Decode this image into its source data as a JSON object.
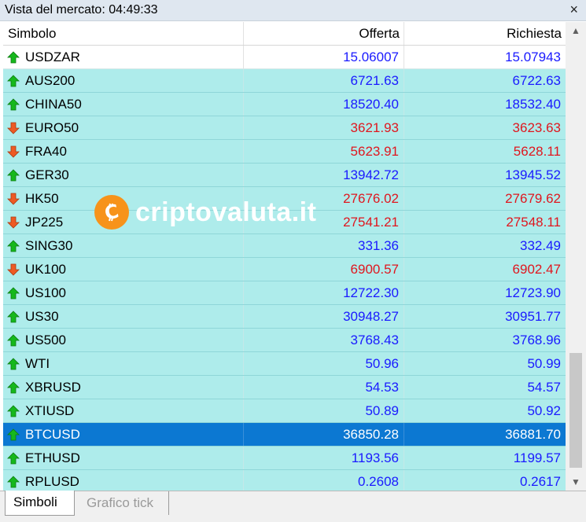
{
  "window": {
    "title": "Vista del mercato: 04:49:33",
    "close_icon": "close-icon"
  },
  "columns": {
    "symbol": "Simbolo",
    "bid": "Offerta",
    "ask": "Richiesta"
  },
  "colors": {
    "up": "#1a1aff",
    "down": "#e0161e",
    "row_bg": "#aeeceb",
    "selected_bg": "#0c78d2"
  },
  "rows": [
    {
      "symbol": "USDZAR",
      "bid": "15.06007",
      "ask": "15.07943",
      "dir": "up"
    },
    {
      "symbol": "AUS200",
      "bid": "6721.63",
      "ask": "6722.63",
      "dir": "up"
    },
    {
      "symbol": "CHINA50",
      "bid": "18520.40",
      "ask": "18532.40",
      "dir": "up"
    },
    {
      "symbol": "EURO50",
      "bid": "3621.93",
      "ask": "3623.63",
      "dir": "down"
    },
    {
      "symbol": "FRA40",
      "bid": "5623.91",
      "ask": "5628.11",
      "dir": "down"
    },
    {
      "symbol": "GER30",
      "bid": "13942.72",
      "ask": "13945.52",
      "dir": "up"
    },
    {
      "symbol": "HK50",
      "bid": "27676.02",
      "ask": "27679.62",
      "dir": "down"
    },
    {
      "symbol": "JP225",
      "bid": "27541.21",
      "ask": "27548.11",
      "dir": "down"
    },
    {
      "symbol": "SING30",
      "bid": "331.36",
      "ask": "332.49",
      "dir": "up"
    },
    {
      "symbol": "UK100",
      "bid": "6900.57",
      "ask": "6902.47",
      "dir": "down"
    },
    {
      "symbol": "US100",
      "bid": "12722.30",
      "ask": "12723.90",
      "dir": "up"
    },
    {
      "symbol": "US30",
      "bid": "30948.27",
      "ask": "30951.77",
      "dir": "up"
    },
    {
      "symbol": "US500",
      "bid": "3768.43",
      "ask": "3768.96",
      "dir": "up"
    },
    {
      "symbol": "WTI",
      "bid": "50.96",
      "ask": "50.99",
      "dir": "up"
    },
    {
      "symbol": "XBRUSD",
      "bid": "54.53",
      "ask": "54.57",
      "dir": "up"
    },
    {
      "symbol": "XTIUSD",
      "bid": "50.89",
      "ask": "50.92",
      "dir": "up"
    },
    {
      "symbol": "BTCUSD",
      "bid": "36850.28",
      "ask": "36881.70",
      "dir": "up",
      "selected": true
    },
    {
      "symbol": "ETHUSD",
      "bid": "1193.56",
      "ask": "1199.57",
      "dir": "up"
    },
    {
      "symbol": "RPLUSD",
      "bid": "0.2608",
      "ask": "0.2617",
      "dir": "up"
    }
  ],
  "tabs": [
    {
      "label": "Simboli",
      "active": true
    },
    {
      "label": "Grafico tick",
      "active": false
    }
  ],
  "watermark": {
    "text": "criptovaluta.it",
    "logo_letter": "₿"
  }
}
